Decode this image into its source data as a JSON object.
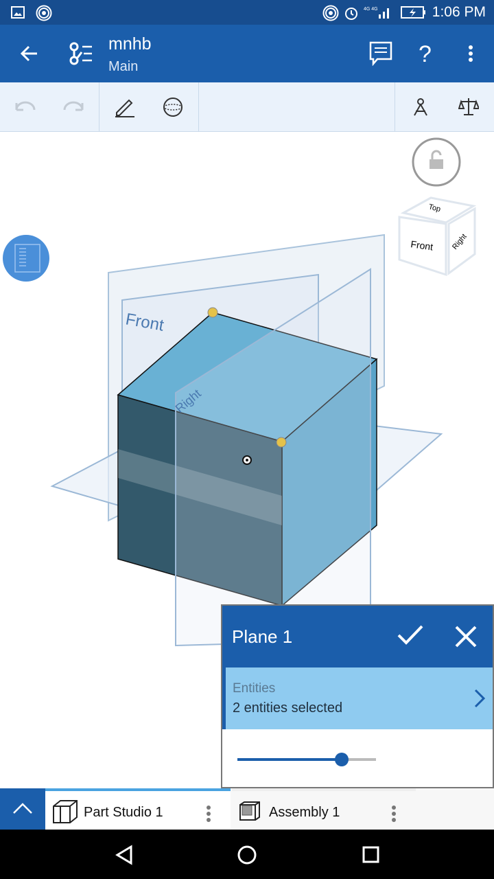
{
  "status_bar": {
    "time": "1:06 PM",
    "icons": [
      "image-icon",
      "hotspot-icon",
      "hotspot-icon",
      "alarm-icon",
      "signal-4g-icon",
      "battery-charging-icon"
    ]
  },
  "app_bar": {
    "title": "mnhb",
    "subtitle": "Main",
    "icons": [
      "back-arrow-icon",
      "version-graph-icon",
      "comment-icon",
      "help-icon",
      "more-vert-icon"
    ]
  },
  "toolbar": {
    "icons": [
      "undo-icon",
      "redo-icon",
      "sketch-pencil-icon",
      "plane-sphere-icon",
      "mass-properties-icon",
      "balance-icon"
    ]
  },
  "viewport": {
    "plane_labels": {
      "front": "Front",
      "right": "Right"
    },
    "view_cube": {
      "top": "Top",
      "front": "Front",
      "right": "Right"
    }
  },
  "feature_panel": {
    "title": "Plane 1",
    "entities_label": "Entities",
    "entities_value": "2 entities selected",
    "slider_fraction": 0.75
  },
  "tabs": [
    {
      "label": "Part Studio 1",
      "active": true
    },
    {
      "label": "Assembly 1",
      "active": false
    }
  ],
  "colors": {
    "primary": "#1b5eab",
    "status": "#174d8f",
    "entities_bg": "#8fcbf0"
  }
}
